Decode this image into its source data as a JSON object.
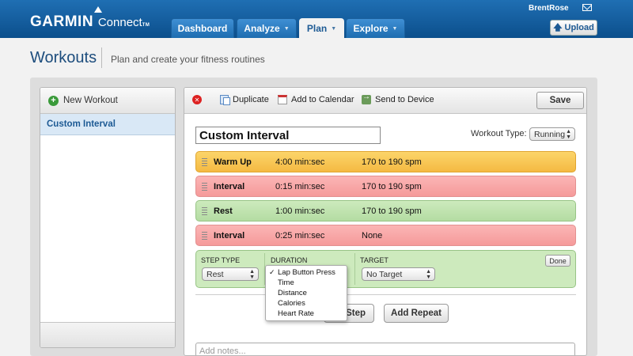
{
  "header": {
    "logo_text": "GARMIN",
    "logo_sub": "Connect",
    "logo_tm": "TM",
    "tabs": [
      {
        "label": "Dashboard"
      },
      {
        "label": "Analyze"
      },
      {
        "label": "Plan"
      },
      {
        "label": "Explore"
      }
    ],
    "active_tab": "Plan",
    "username": "BrentRose",
    "upload_label": "Upload",
    "upload_icon": "arrow-up-icon"
  },
  "page": {
    "title": "Workouts",
    "subtitle": "Plan and create your fitness routines"
  },
  "sidebar": {
    "new_workout_label": "New Workout",
    "items": [
      {
        "label": "Custom Interval",
        "selected": true
      }
    ]
  },
  "toolbar": {
    "duplicate_label": "Duplicate",
    "calendar_label": "Add to Calendar",
    "send_label": "Send to Device",
    "save_label": "Save"
  },
  "workout": {
    "name": "Custom Interval",
    "type_label": "Workout Type:",
    "type_value": "Running",
    "steps": [
      {
        "name": "Warm Up",
        "duration": "4:00 min:sec",
        "target": "170 to 190 spm",
        "color": "#f4b942"
      },
      {
        "name": "Interval",
        "duration": "0:15 min:sec",
        "target": "170 to 190 spm",
        "color": "#f59a9a"
      },
      {
        "name": "Rest",
        "duration": "1:00 min:sec",
        "target": "170 to 190 spm",
        "color": "#b4dca2"
      },
      {
        "name": "Interval",
        "duration": "0:25 min:sec",
        "target": "None",
        "color": "#f59a9a"
      }
    ]
  },
  "editor": {
    "step_type_label": "STEP TYPE",
    "step_type_value": "Rest",
    "duration_label": "DURATION",
    "target_label": "TARGET",
    "target_value": "No Target",
    "done_label": "Done",
    "duration_options": [
      {
        "label": "Lap Button Press",
        "checked": true
      },
      {
        "label": "Time",
        "checked": false
      },
      {
        "label": "Distance",
        "checked": false
      },
      {
        "label": "Calories",
        "checked": false
      },
      {
        "label": "Heart Rate",
        "checked": false
      }
    ]
  },
  "actions": {
    "add_step_label": "Step",
    "add_repeat_label": "Add Repeat"
  },
  "notes": {
    "placeholder": "Add notes..."
  }
}
